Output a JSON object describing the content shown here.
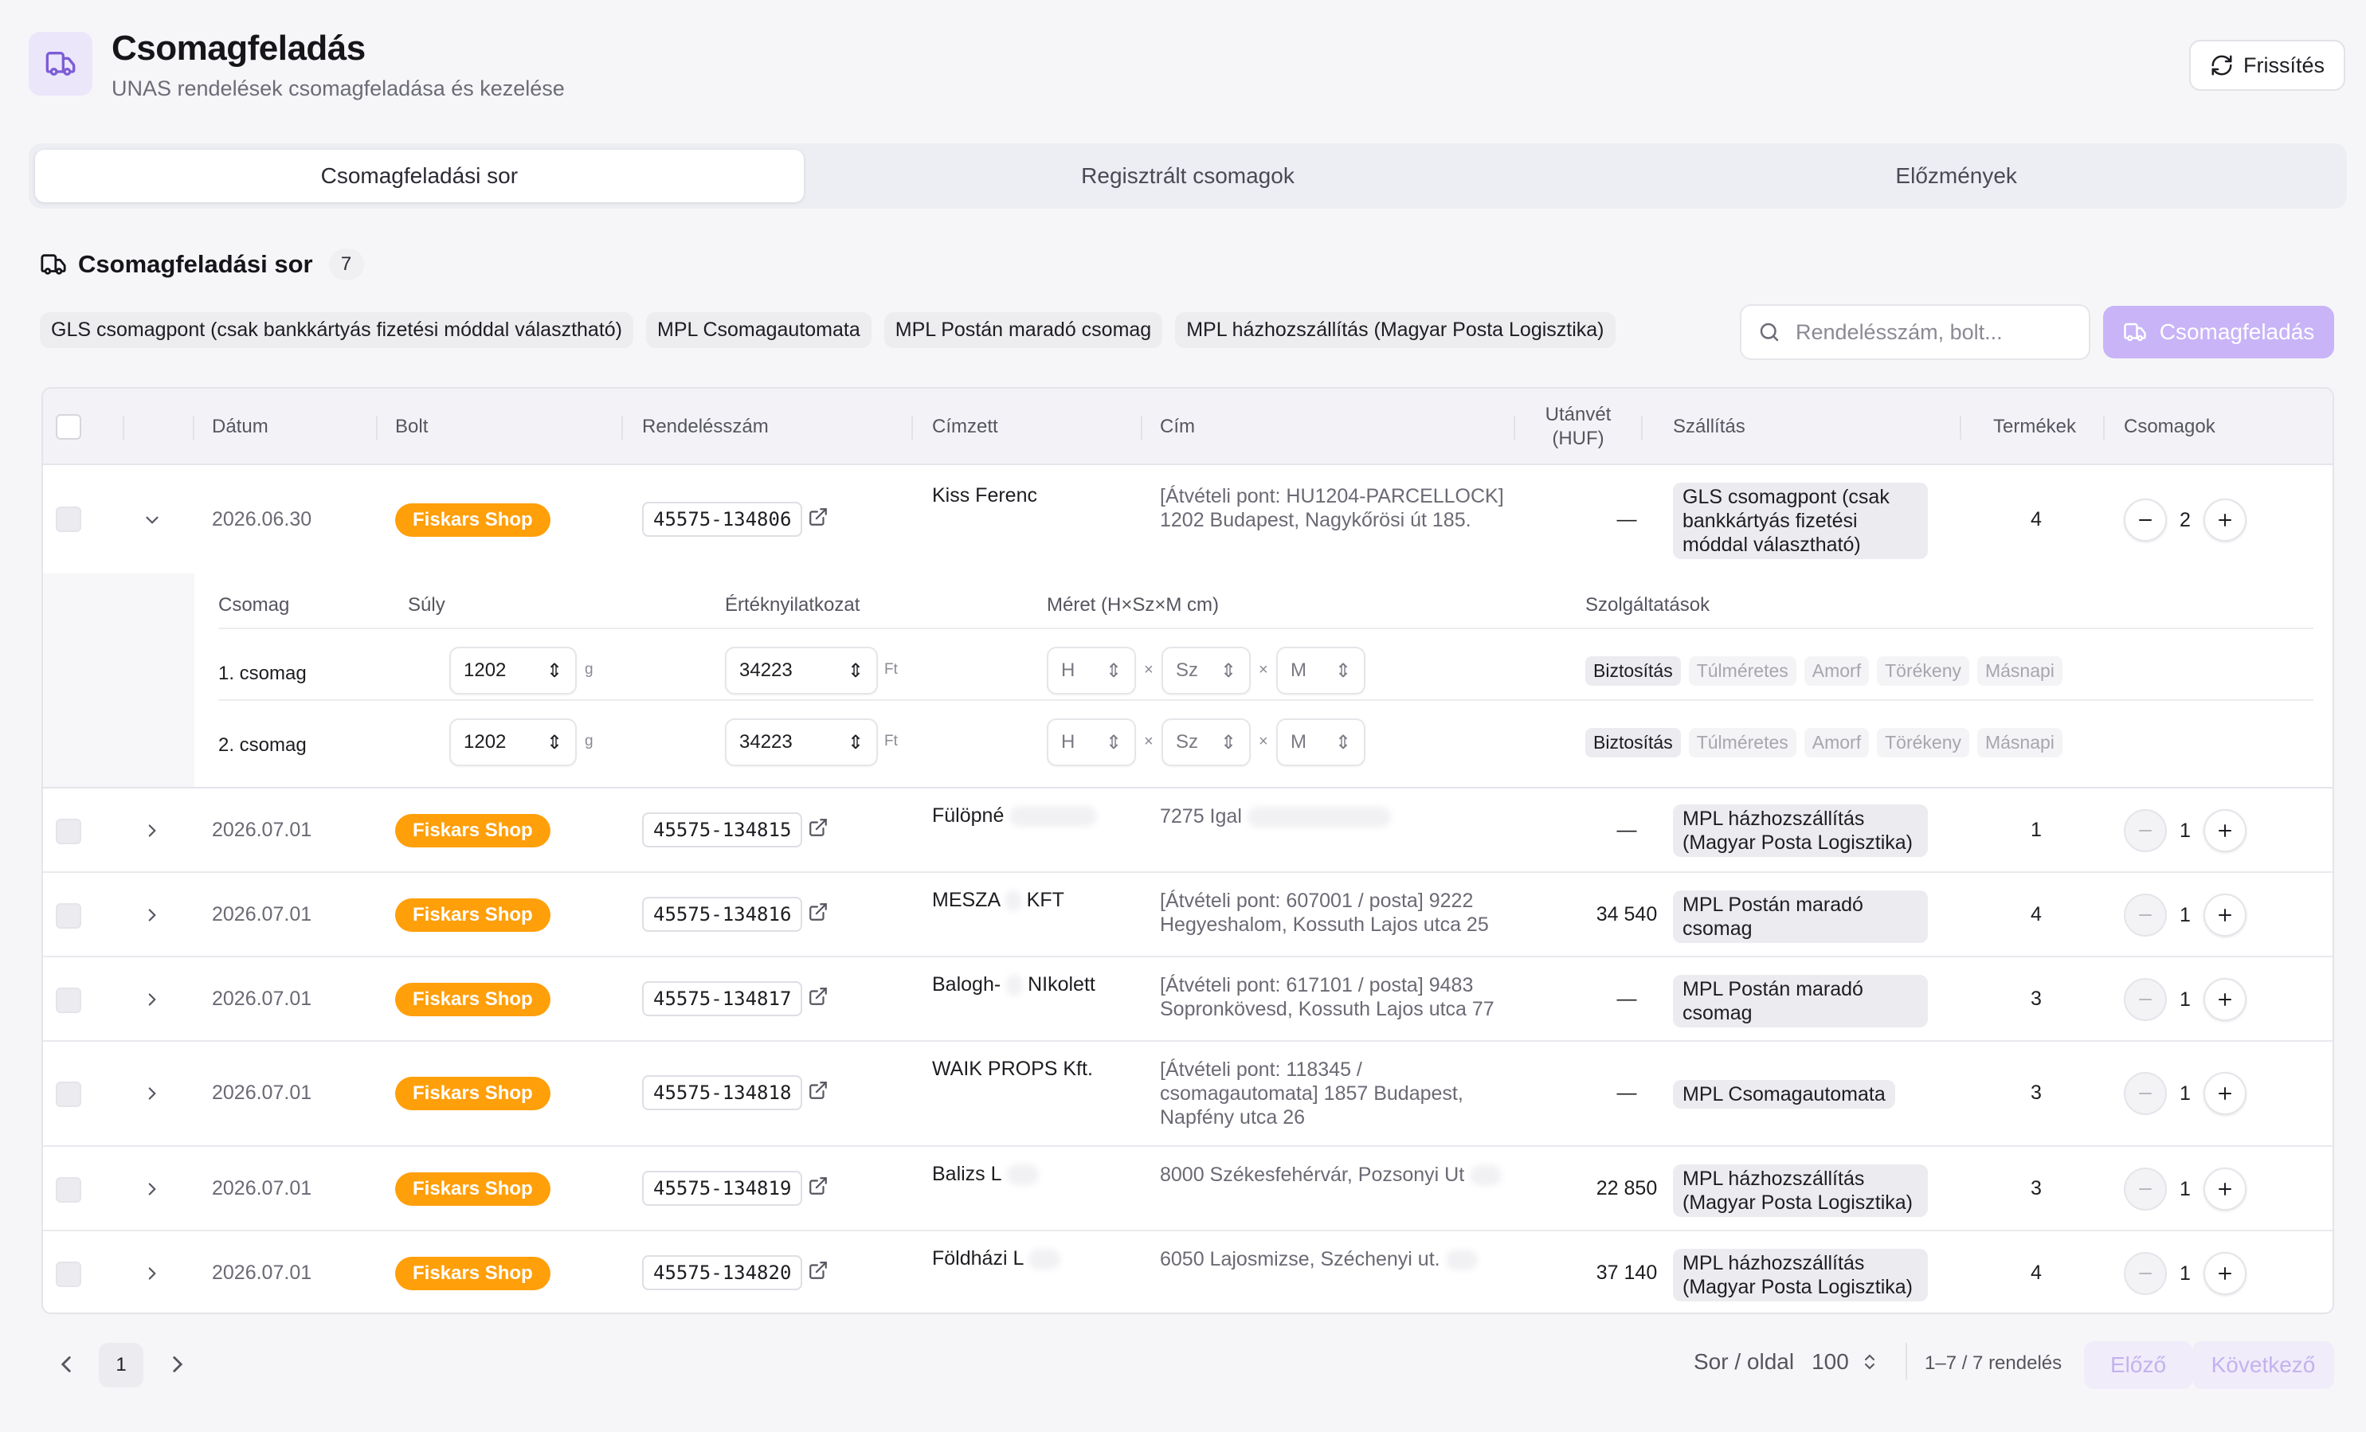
{
  "header": {
    "title": "Csomagfeladás",
    "subtitle": "UNAS rendelések csomagfeladása és kezelése",
    "refresh_label": "Frissítés",
    "icon": "truck-icon"
  },
  "tabs": [
    {
      "label": "Csomagfeladási sor",
      "active": true
    },
    {
      "label": "Regisztrált csomagok",
      "active": false
    },
    {
      "label": "Előzmények",
      "active": false
    }
  ],
  "section": {
    "title": "Csomagfeladási sor",
    "count": "7"
  },
  "filters": [
    "GLS csomagpont (csak bankkártyás fizetési móddal választható)",
    "MPL Csomagautomata",
    "MPL Postán maradó csomag",
    "MPL házhozszállítás (Magyar Posta Logisztika)"
  ],
  "search": {
    "placeholder": "Rendelésszám, bolt...",
    "value": ""
  },
  "ship_button_label": "Csomagfeladás",
  "table": {
    "headers": {
      "date": "Dátum",
      "shop": "Bolt",
      "order": "Rendelésszám",
      "recipient": "Címzett",
      "address": "Cím",
      "cod": "Utánvét (HUF)",
      "shipping": "Szállítás",
      "products": "Termékek",
      "packages": "Csomagok"
    },
    "rows": [
      {
        "date": "2026.06.30",
        "shop": "Fiskars Shop",
        "order": "45575-134806",
        "recipient": "Kiss Ferenc",
        "address": "[Átvételi pont: HU1204-PARCELLOCK] 1202 Budapest, Nagykőrösi út 185.",
        "cod": "—",
        "shipping": "GLS csomagpont (csak bankkártyás fizetési móddal választható)",
        "products": "4",
        "packages": "2",
        "expanded": true
      },
      {
        "date": "2026.07.01",
        "shop": "Fiskars Shop",
        "order": "45575-134815",
        "recipient": "Fülöpné",
        "address": "7275 Igal",
        "cod": "—",
        "shipping": "MPL házhozszállítás (Magyar Posta Logisztika)",
        "products": "1",
        "packages": "1",
        "expanded": false
      },
      {
        "date": "2026.07.01",
        "shop": "Fiskars Shop",
        "order": "45575-134816",
        "recipient": "MESZA",
        "recipient_suffix": "KFT",
        "address": "[Átvételi pont: 607001 / posta] 9222 Hegyeshalom, Kossuth Lajos utca 25",
        "cod": "34 540",
        "shipping": "MPL Postán maradó csomag",
        "products": "4",
        "packages": "1",
        "expanded": false
      },
      {
        "date": "2026.07.01",
        "shop": "Fiskars Shop",
        "order": "45575-134817",
        "recipient": "Balogh-",
        "recipient_suffix": "NIkolett",
        "address": "[Átvételi pont: 617101 / posta] 9483 Sopronkövesd, Kossuth Lajos utca 77",
        "cod": "—",
        "shipping": "MPL Postán maradó csomag",
        "products": "3",
        "packages": "1",
        "expanded": false
      },
      {
        "date": "2026.07.01",
        "shop": "Fiskars Shop",
        "order": "45575-134818",
        "recipient": "WAIK PROPS Kft.",
        "address": "[Átvételi pont: 118345 / csomagautomata] 1857 Budapest, Napfény utca 26",
        "cod": "—",
        "shipping": "MPL Csomagautomata",
        "products": "3",
        "packages": "1",
        "expanded": false
      },
      {
        "date": "2026.07.01",
        "shop": "Fiskars Shop",
        "order": "45575-134819",
        "recipient": "Balizs L",
        "address": "8000 Székesfehérvár, Pozsonyi Ut",
        "cod": "22 850",
        "shipping": "MPL házhozszállítás (Magyar Posta Logisztika)",
        "products": "3",
        "packages": "1",
        "expanded": false
      },
      {
        "date": "2026.07.01",
        "shop": "Fiskars Shop",
        "order": "45575-134820",
        "recipient": "Földházi L",
        "address": "6050 Lajosmizse, Széchenyi ut.",
        "cod": "37 140",
        "shipping": "MPL házhozszállítás (Magyar Posta Logisztika)",
        "products": "4",
        "packages": "1",
        "expanded": false
      }
    ]
  },
  "expanded": {
    "headers": {
      "package": "Csomag",
      "weight": "Súly",
      "value": "Értéknyilatkozat",
      "size": "Méret (H×Sz×M cm)",
      "services": "Szolgáltatások"
    },
    "weight_unit": "g",
    "value_unit": "Ft",
    "size_placeholders": {
      "h": "H",
      "sz": "Sz",
      "m": "M"
    },
    "size_sep": "×",
    "services": [
      "Biztosítás",
      "Túlméretes",
      "Amorf",
      "Törékeny",
      "Másnapi"
    ],
    "packages": [
      {
        "label": "1. csomag",
        "weight": "1202",
        "value": "34223",
        "insurance": true
      },
      {
        "label": "2. csomag",
        "weight": "1202",
        "value": "34223",
        "insurance": true
      }
    ]
  },
  "footer": {
    "page": "1",
    "per_page_label": "Sor / oldal",
    "per_page_value": "100",
    "range_text": "1–7 / 7 rendelés",
    "prev_label": "Előző",
    "next_label": "Következő"
  },
  "colors": {
    "accent": "#c8b4f7",
    "shop_badge": "#ff9f0a",
    "icon_bg": "#ece6fb"
  }
}
